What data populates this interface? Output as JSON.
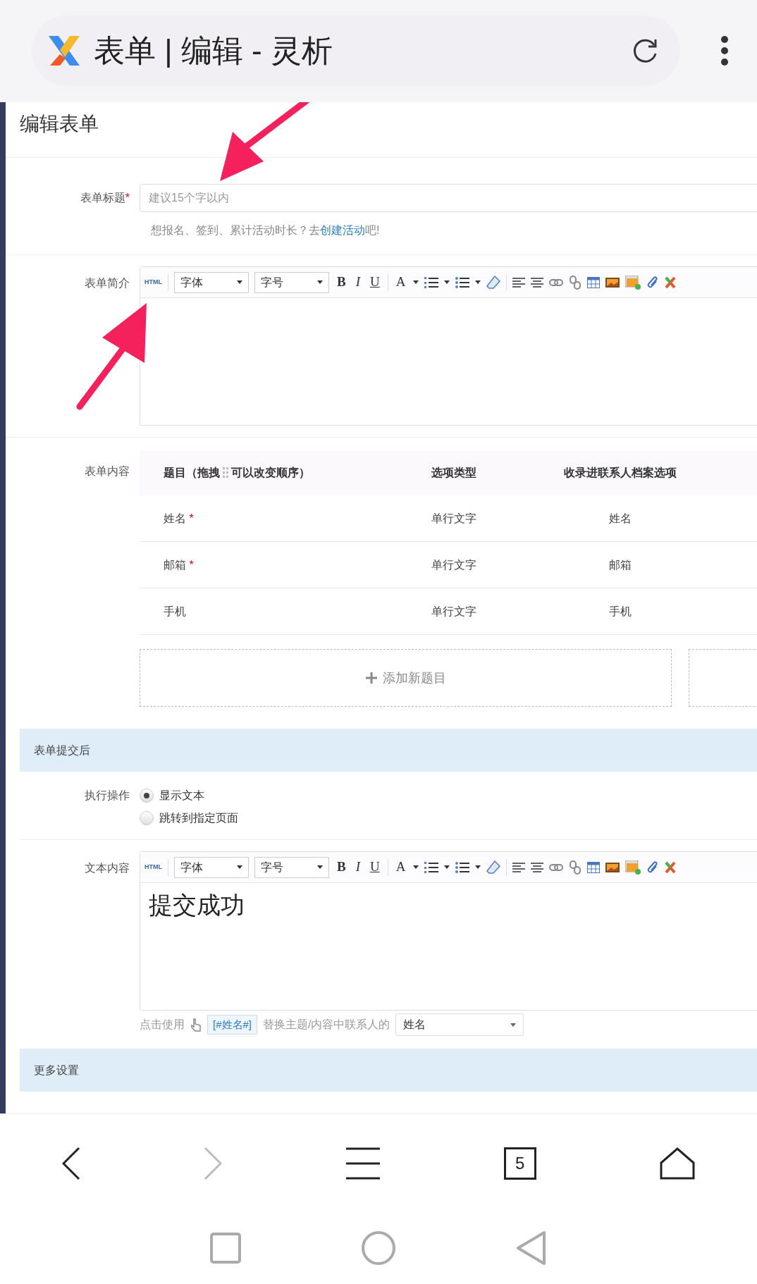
{
  "browser": {
    "title": "表单 | 编辑 - 灵析"
  },
  "page_title": "编辑表单",
  "form_title": {
    "label": "表单标题",
    "required_mark": "*",
    "placeholder": "建议15个字以内",
    "hint": {
      "text": "想报名、签到、累计活动时长？去",
      "link": "创建活动",
      "after": "吧!"
    }
  },
  "intro": {
    "label": "表单简介",
    "toolbar": {
      "html": "HTML",
      "font": "字体",
      "size": "字号",
      "bold": "B",
      "italic": "I",
      "underline": "U",
      "font_color_label": "A"
    }
  },
  "content": {
    "label": "表单内容",
    "question_header": {
      "before": "题目（拖拽",
      "after": "可以改变顺序）"
    },
    "columns": [
      "选项类型",
      "收录进联系人档案选项"
    ],
    "rows": [
      {
        "title": "姓名",
        "required_mark": "*",
        "type": "单行文字",
        "field": "姓名"
      },
      {
        "title": "邮箱",
        "required_mark": "*",
        "type": "单行文字",
        "field": "邮箱"
      },
      {
        "title": "手机",
        "type": "单行文字",
        "field": "手机"
      }
    ],
    "add_button": "添加新题目"
  },
  "after_submit": {
    "heading": "表单提交后",
    "action_label": "执行操作",
    "options": [
      {
        "label": "显示文本",
        "selected": true
      },
      {
        "label": "跳转到指定页面",
        "selected": false
      }
    ],
    "text_label": "文本内容",
    "toolbar": {
      "html": "HTML",
      "font": "字体",
      "size": "字号",
      "bold": "B",
      "italic": "I",
      "underline": "U",
      "font_color_label": "A"
    },
    "text": "提交成功",
    "footer": {
      "prefix": "点击使用",
      "tag": "[#姓名#]",
      "middle": "替换主题/内容中联系人的",
      "select": "姓名"
    }
  },
  "more_settings": {
    "heading": "更多设置"
  },
  "bottom_nav": {
    "tab_count": "5",
    "forward_disabled": true
  }
}
